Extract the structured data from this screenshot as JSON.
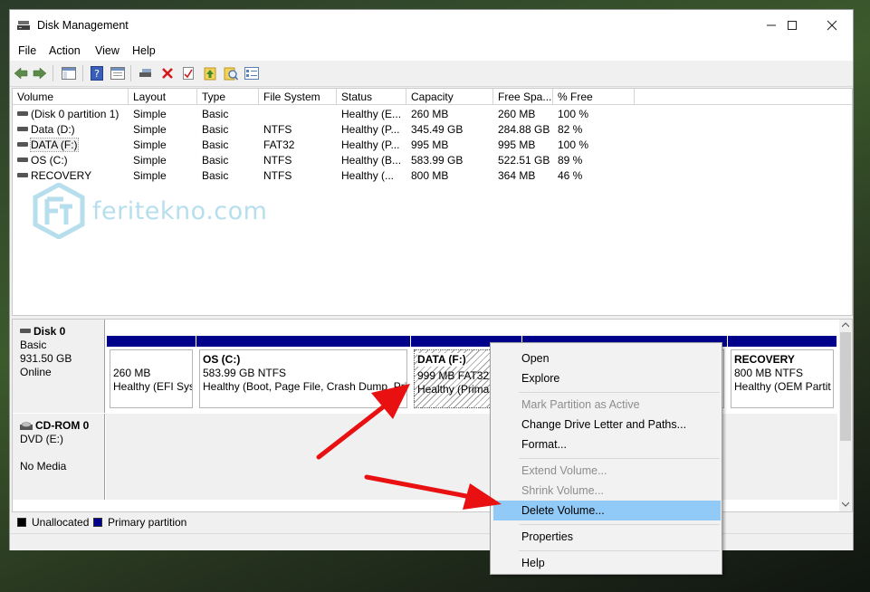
{
  "window": {
    "title": "Disk Management",
    "minimize": "—",
    "maximize": "☐",
    "close": "✕"
  },
  "menu": [
    "File",
    "Action",
    "View",
    "Help"
  ],
  "toolbar_icons": [
    "back-arrow-icon",
    "forward-arrow-icon",
    "console-tree-icon",
    "help-icon",
    "properties-icon",
    "connect-icon",
    "delete-icon",
    "check-icon",
    "rescan-icon",
    "refresh-icon",
    "view-icon"
  ],
  "volume_list": {
    "headers": [
      "Volume",
      "Layout",
      "Type",
      "File System",
      "Status",
      "Capacity",
      "Free Spa...",
      "% Free"
    ],
    "rows": [
      [
        "(Disk 0 partition 1)",
        "Simple",
        "Basic",
        "",
        "Healthy (E...",
        "260 MB",
        "260 MB",
        "100 %"
      ],
      [
        "Data (D:)",
        "Simple",
        "Basic",
        "NTFS",
        "Healthy (P...",
        "345.49 GB",
        "284.88 GB",
        "82 %"
      ],
      [
        "DATA (F:)",
        "Simple",
        "Basic",
        "FAT32",
        "Healthy (P...",
        "995 MB",
        "995 MB",
        "100 %"
      ],
      [
        "OS (C:)",
        "Simple",
        "Basic",
        "NTFS",
        "Healthy (B...",
        "583.99 GB",
        "522.51 GB",
        "89 %"
      ],
      [
        "RECOVERY",
        "Simple",
        "Basic",
        "NTFS",
        "Healthy (...",
        "800 MB",
        "364 MB",
        "46 %"
      ]
    ]
  },
  "watermark": {
    "logo": "FT",
    "text": "feritekno.com"
  },
  "disks": [
    {
      "name": "Disk 0",
      "type": "Basic",
      "size": "931.50 GB",
      "status": "Online",
      "partitions": [
        {
          "name": "",
          "size": "260 MB",
          "status": "Healthy (EFI Sys"
        },
        {
          "name": "OS  (C:)",
          "size": "583.99 GB NTFS",
          "status": "Healthy (Boot, Page File, Crash Dump, Pri"
        },
        {
          "name": "DATA  (F:)",
          "size": "999 MB FAT32",
          "status": "Healthy (Primar"
        },
        {
          "name": "",
          "size": "",
          "status": ""
        },
        {
          "name": "RECOVERY",
          "size": "800 MB NTFS",
          "status": "Healthy (OEM Partit"
        }
      ]
    },
    {
      "name": "CD-ROM 0",
      "type": "DVD (E:)",
      "size": "",
      "status": "No Media",
      "partitions": []
    }
  ],
  "legend": [
    {
      "label": "Unallocated",
      "color": "#000000"
    },
    {
      "label": "Primary partition",
      "color": "#00008b"
    }
  ],
  "context_menu": [
    {
      "label": "Open",
      "enabled": true
    },
    {
      "label": "Explore",
      "enabled": true
    },
    {
      "label": "Mark Partition as Active",
      "enabled": false
    },
    {
      "label": "Change Drive Letter and Paths...",
      "enabled": true
    },
    {
      "label": "Format...",
      "enabled": true
    },
    {
      "label": "Extend Volume...",
      "enabled": false
    },
    {
      "label": "Shrink Volume...",
      "enabled": false
    },
    {
      "label": "Delete Volume...",
      "enabled": true,
      "highlighted": true
    },
    {
      "label": "Properties",
      "enabled": true
    },
    {
      "label": "Help",
      "enabled": true
    }
  ],
  "colors": {
    "primary_partition": "#00008b",
    "menu_highlight": "#91c9f7",
    "annotation_arrow": "#e81010"
  }
}
